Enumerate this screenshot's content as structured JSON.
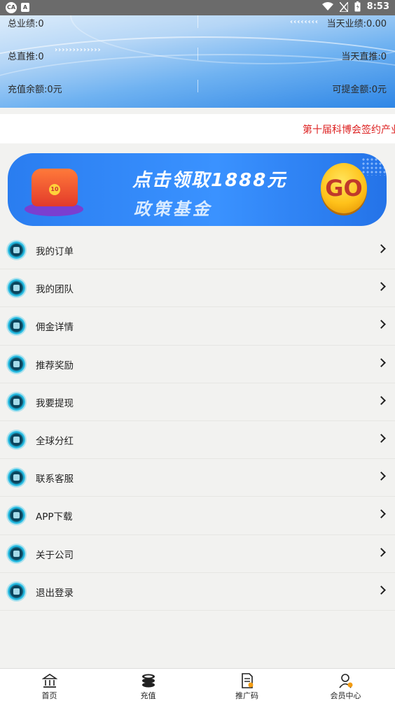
{
  "status_bar": {
    "time": "8:53"
  },
  "stats": {
    "total_performance": "总业绩:0",
    "today_performance": "当天业绩:0.00",
    "total_direct": "总直推:0",
    "today_direct": "当天直推:0",
    "recharge_balance": "充值余额:0元",
    "withdrawable": "可提金额:0元"
  },
  "marquee": {
    "text": "第十届科博会签约产业"
  },
  "banner": {
    "line1": "点击领取1888元",
    "line2": "政策基金",
    "go": "GO"
  },
  "menu": [
    {
      "label": "我的订单",
      "icon": "orders-icon"
    },
    {
      "label": "我的团队",
      "icon": "team-icon"
    },
    {
      "label": "佣金详情",
      "icon": "commission-icon"
    },
    {
      "label": "推荐奖励",
      "icon": "reward-icon"
    },
    {
      "label": "我要提现",
      "icon": "withdraw-icon"
    },
    {
      "label": "全球分红",
      "icon": "globe-icon"
    },
    {
      "label": "联系客服",
      "icon": "service-icon"
    },
    {
      "label": "APP下载",
      "icon": "download-icon"
    },
    {
      "label": "关于公司",
      "icon": "company-icon"
    },
    {
      "label": "退出登录",
      "icon": "logout-icon"
    }
  ],
  "tabbar": [
    {
      "label": "首页",
      "icon": "home-icon"
    },
    {
      "label": "充值",
      "icon": "coins-icon"
    },
    {
      "label": "推广码",
      "icon": "qrcode-doc-icon"
    },
    {
      "label": "会员中心",
      "icon": "member-icon"
    }
  ]
}
